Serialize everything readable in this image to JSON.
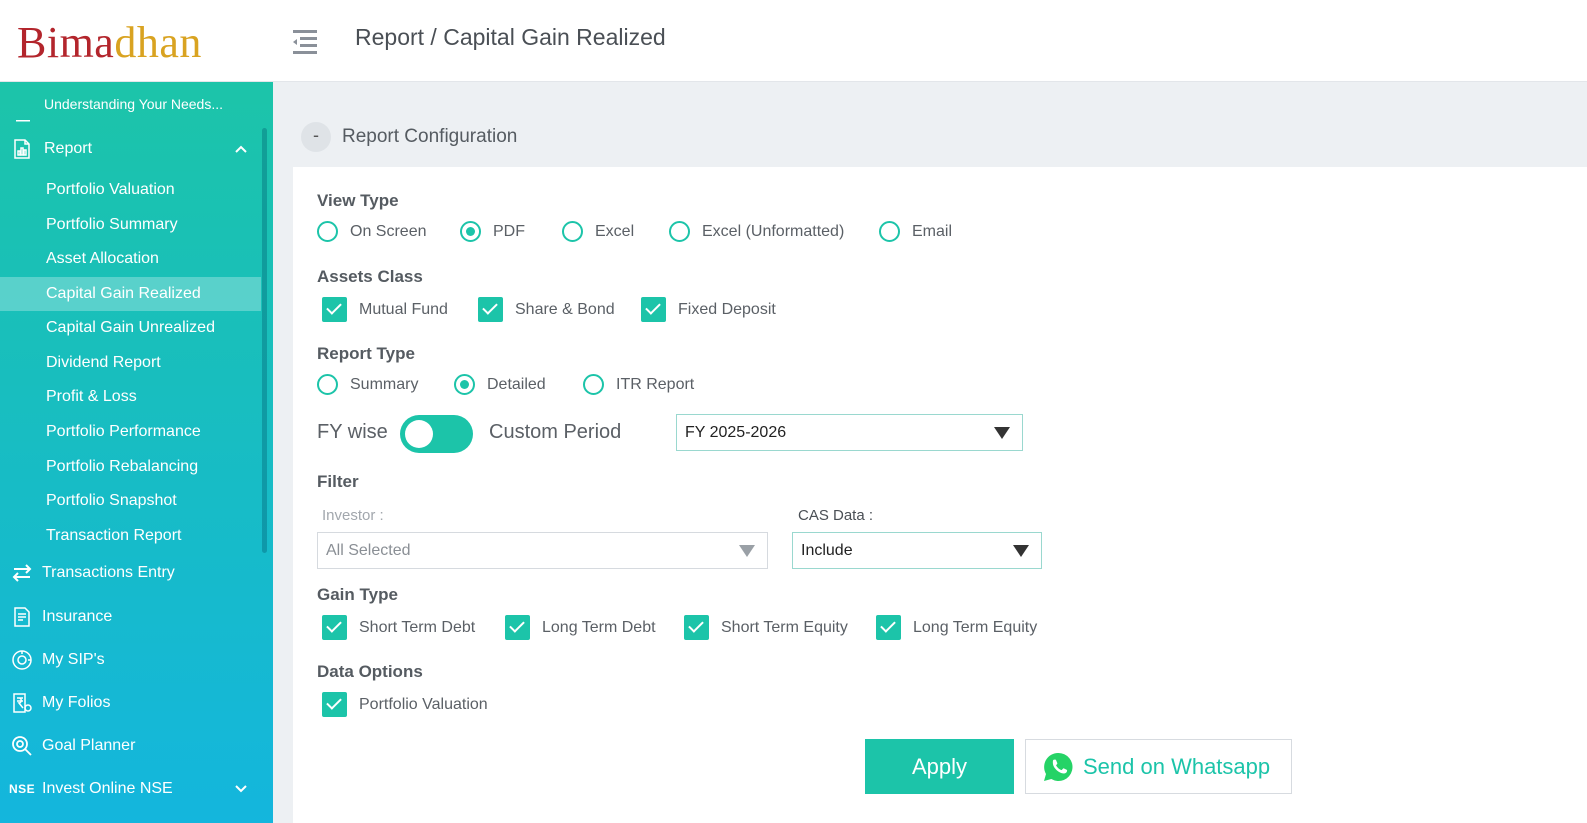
{
  "app": {
    "logo_part1": "Bima",
    "logo_part2": "dhan"
  },
  "header": {
    "breadcrumb": "Report / Capital Gain Realized"
  },
  "sidebar": {
    "top_item": "Understanding Your Needs...",
    "report": {
      "label": "Report",
      "expanded": true
    },
    "report_items": [
      "Portfolio Valuation",
      "Portfolio Summary",
      "Asset Allocation",
      "Capital Gain Realized",
      "Capital Gain Unrealized",
      "Dividend Report",
      "Profit & Loss",
      "Portfolio Performance",
      "Portfolio Rebalancing",
      "Portfolio Snapshot",
      "Transaction Report"
    ],
    "active_item": "Capital Gain Realized",
    "menu": {
      "transactions": "Transactions Entry",
      "insurance": "Insurance",
      "sips": "My SIP's",
      "folios": "My Folios",
      "goal": "Goal Planner",
      "nse_badge": "NSE",
      "nse": "Invest Online NSE"
    }
  },
  "config": {
    "title": "Report Configuration",
    "collapse_symbol": "-",
    "view_type": {
      "title": "View Type",
      "options": [
        "On Screen",
        "PDF",
        "Excel",
        "Excel (Unformatted)",
        "Email"
      ],
      "selected": "PDF"
    },
    "assets_class": {
      "title": "Assets Class",
      "options": [
        "Mutual Fund",
        "Share & Bond",
        "Fixed Deposit"
      ],
      "checked": [
        "Mutual Fund",
        "Share & Bond",
        "Fixed Deposit"
      ]
    },
    "report_type": {
      "title": "Report Type",
      "options": [
        "Summary",
        "Detailed",
        "ITR Report"
      ],
      "selected": "Detailed"
    },
    "period": {
      "left_label": "FY wise",
      "right_label": "Custom Period",
      "fy_value": "FY 2025-2026"
    },
    "filter": {
      "title": "Filter",
      "investor_label": "Investor :",
      "investor_value": "All Selected",
      "cas_label": "CAS Data :",
      "cas_value": "Include"
    },
    "gain_type": {
      "title": "Gain Type",
      "options": [
        "Short Term Debt",
        "Long Term Debt",
        "Short Term Equity",
        "Long Term Equity"
      ],
      "checked": [
        "Short Term Debt",
        "Long Term Debt",
        "Short Term Equity",
        "Long Term Equity"
      ]
    },
    "data_options": {
      "title": "Data Options",
      "options": [
        "Portfolio Valuation"
      ],
      "checked": [
        "Portfolio Valuation"
      ]
    },
    "buttons": {
      "apply": "Apply",
      "whatsapp": "Send on Whatsapp"
    }
  },
  "colors": {
    "accent": "#1cc4a9",
    "sidebar_bottom": "#14b6dd",
    "logo_red": "#b3252c",
    "logo_gold": "#d9a321",
    "whatsapp": "#25d366"
  }
}
